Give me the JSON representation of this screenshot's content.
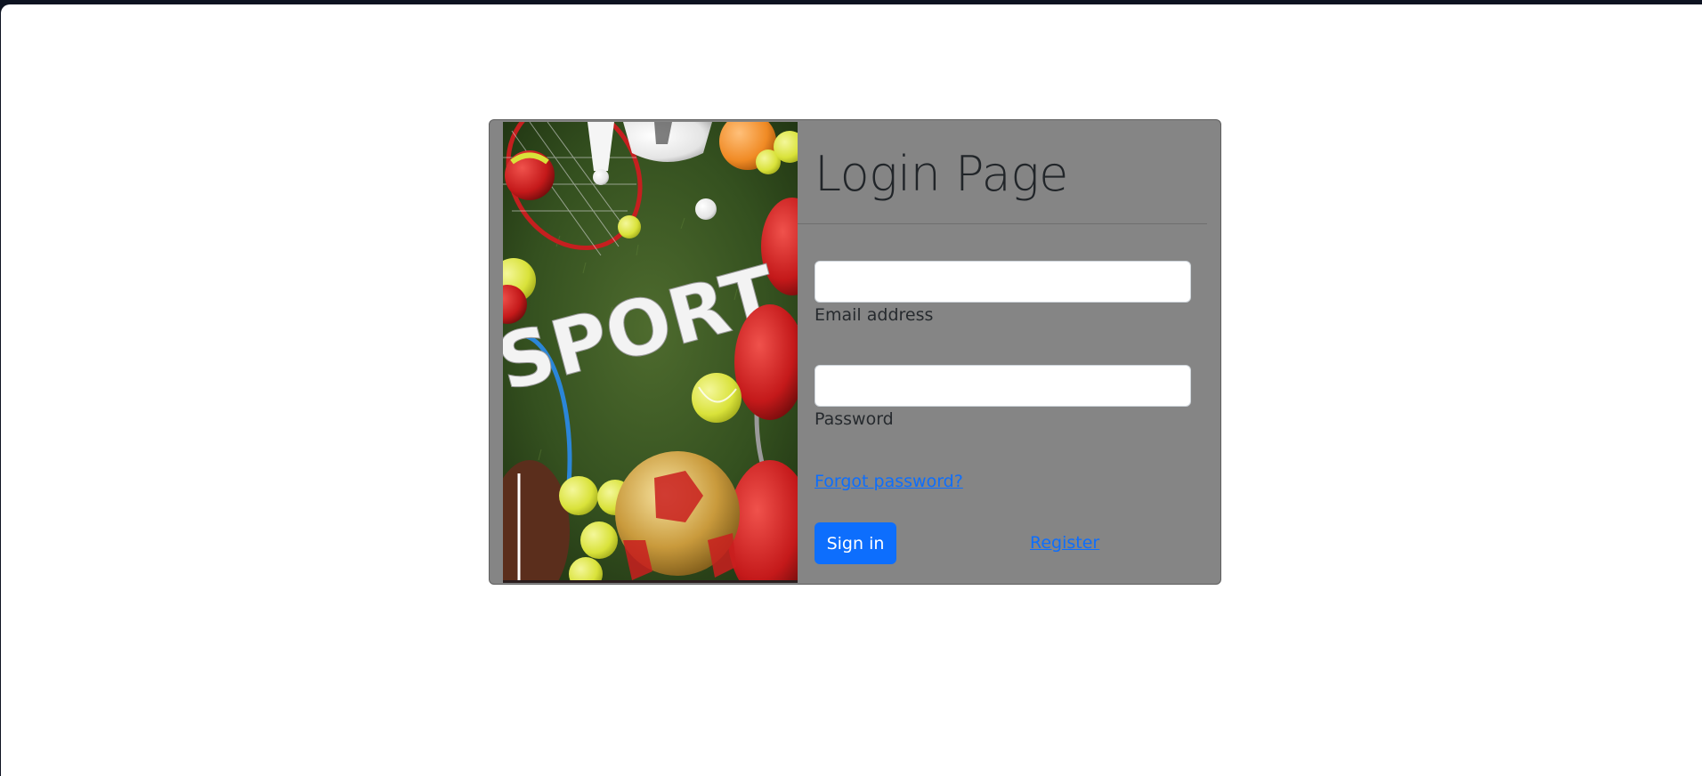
{
  "login": {
    "title": "Login Page",
    "email_label": "Email address",
    "email_value": "",
    "password_label": "Password",
    "password_value": "",
    "forgot_link": "Forgot password?",
    "signin_button": "Sign in",
    "register_link": "Register"
  },
  "image": {
    "text": "SPORT",
    "description_icon": "sports-balls-image"
  },
  "colors": {
    "card_background": "#858585",
    "primary": "#0d6efd",
    "page_background": "#ffffff"
  }
}
